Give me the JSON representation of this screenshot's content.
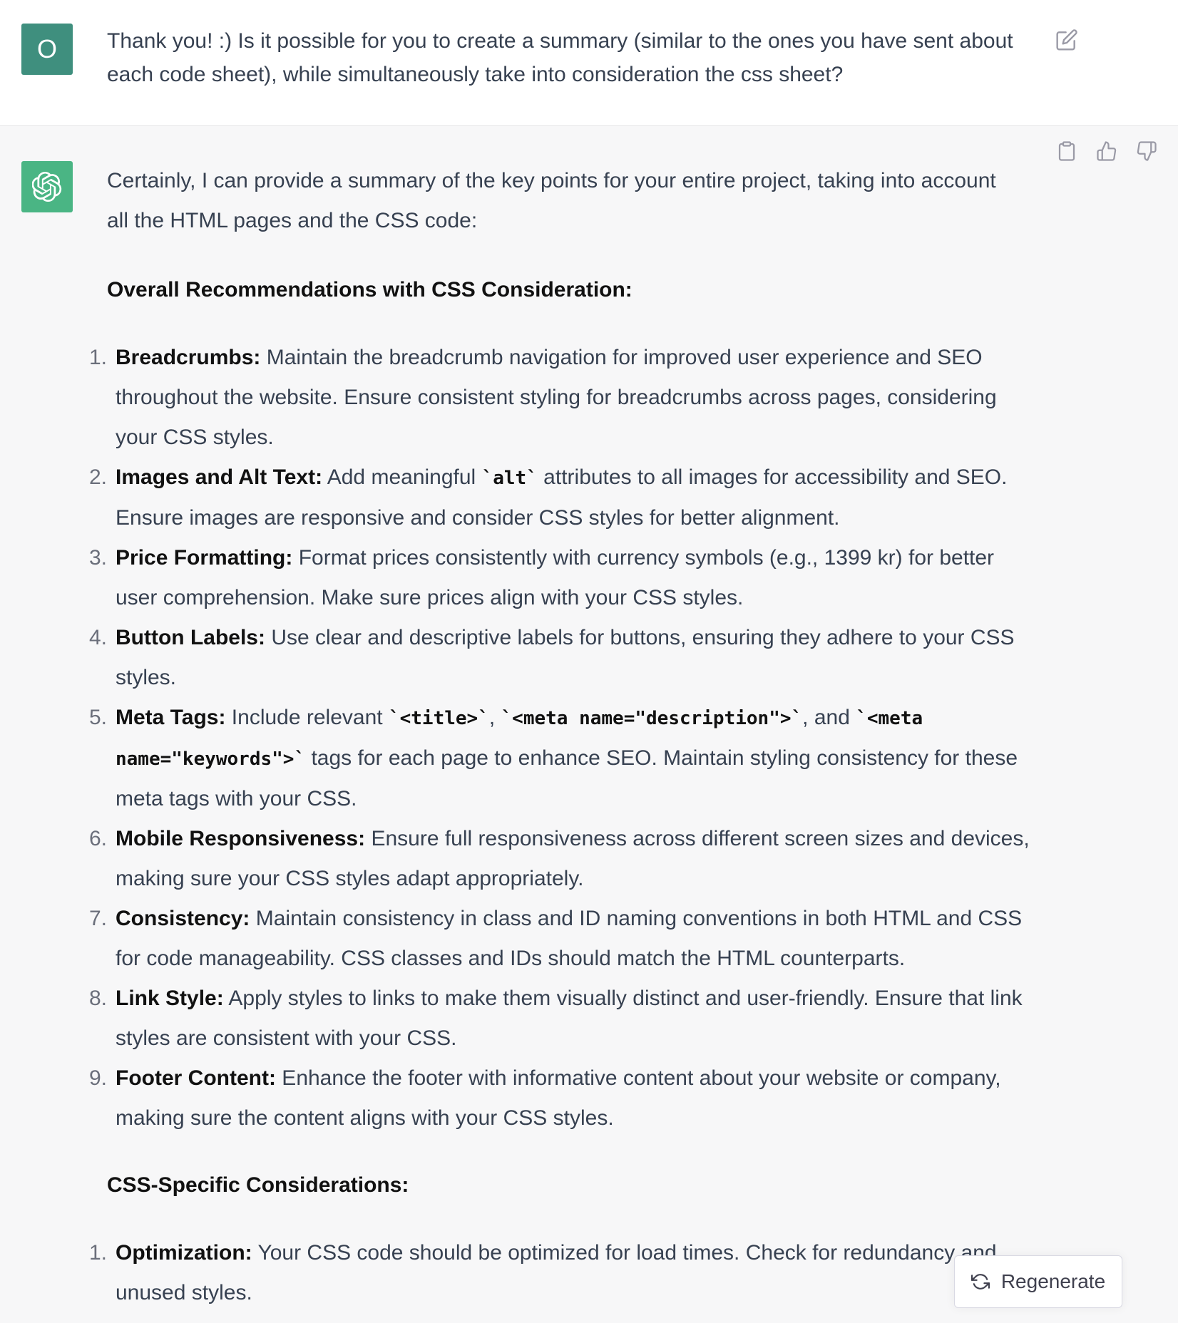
{
  "user_message": {
    "avatar_letter": "O",
    "text": "Thank you! :) Is it possible for you to create a summary (similar to the ones you have sent about each code sheet), while simultaneously take into consideration the css sheet?"
  },
  "assistant_message": {
    "intro": "Certainly, I can provide a summary of the key points for your entire project, taking into account all the HTML pages and the CSS code:",
    "section1_title": "Overall Recommendations with CSS Consideration:",
    "items": [
      {
        "num": "1.",
        "title": "Breadcrumbs:",
        "parts": [
          " Maintain the breadcrumb navigation for improved user experience and SEO throughout the website. Ensure consistent styling for breadcrumbs across pages, considering your CSS styles."
        ]
      },
      {
        "num": "2.",
        "title": "Images and Alt Text:",
        "text_a": " Add meaningful ",
        "code_a": "`alt`",
        "text_b": " attributes to all images for accessibility and SEO. Ensure images are responsive and consider CSS styles for better alignment."
      },
      {
        "num": "3.",
        "title": "Price Formatting:",
        "text": " Format prices consistently with currency symbols (e.g., 1399 kr) for better user comprehension. Make sure prices align with your CSS styles."
      },
      {
        "num": "4.",
        "title": "Button Labels:",
        "text": " Use clear and descriptive labels for buttons, ensuring they adhere to your CSS styles."
      },
      {
        "num": "5.",
        "title": "Meta Tags:",
        "text_a": " Include relevant ",
        "code_a": "`<title>`",
        "text_b": ", ",
        "code_b": "`<meta name=\"description\">`",
        "text_c": ", and ",
        "code_c": "`<meta name=\"keywords\">`",
        "text_d": " tags for each page to enhance SEO. Maintain styling consistency for these meta tags with your CSS."
      },
      {
        "num": "6.",
        "title": "Mobile Responsiveness:",
        "text": " Ensure full responsiveness across different screen sizes and devices, making sure your CSS styles adapt appropriately."
      },
      {
        "num": "7.",
        "title": "Consistency:",
        "text": " Maintain consistency in class and ID naming conventions in both HTML and CSS for code manageability. CSS classes and IDs should match the HTML counterparts."
      },
      {
        "num": "8.",
        "title": "Link Style:",
        "text": " Apply styles to links to make them visually distinct and user-friendly. Ensure that link styles are consistent with your CSS."
      },
      {
        "num": "9.",
        "title": "Footer Content:",
        "text": " Enhance the footer with informative content about your website or company, making sure the content aligns with your CSS styles."
      }
    ],
    "section2_title": "CSS-Specific Considerations:",
    "items2": [
      {
        "num": "1.",
        "title": "Optimization:",
        "text": " Your CSS code should be optimized for load times. Check for redundancy and unused styles."
      }
    ]
  },
  "controls": {
    "regenerate_label": "Regenerate",
    "icons": [
      "edit-icon",
      "copy-icon",
      "thumbs-up-icon",
      "thumbs-down-icon",
      "regenerate-icon",
      "openai-logo-icon"
    ]
  }
}
